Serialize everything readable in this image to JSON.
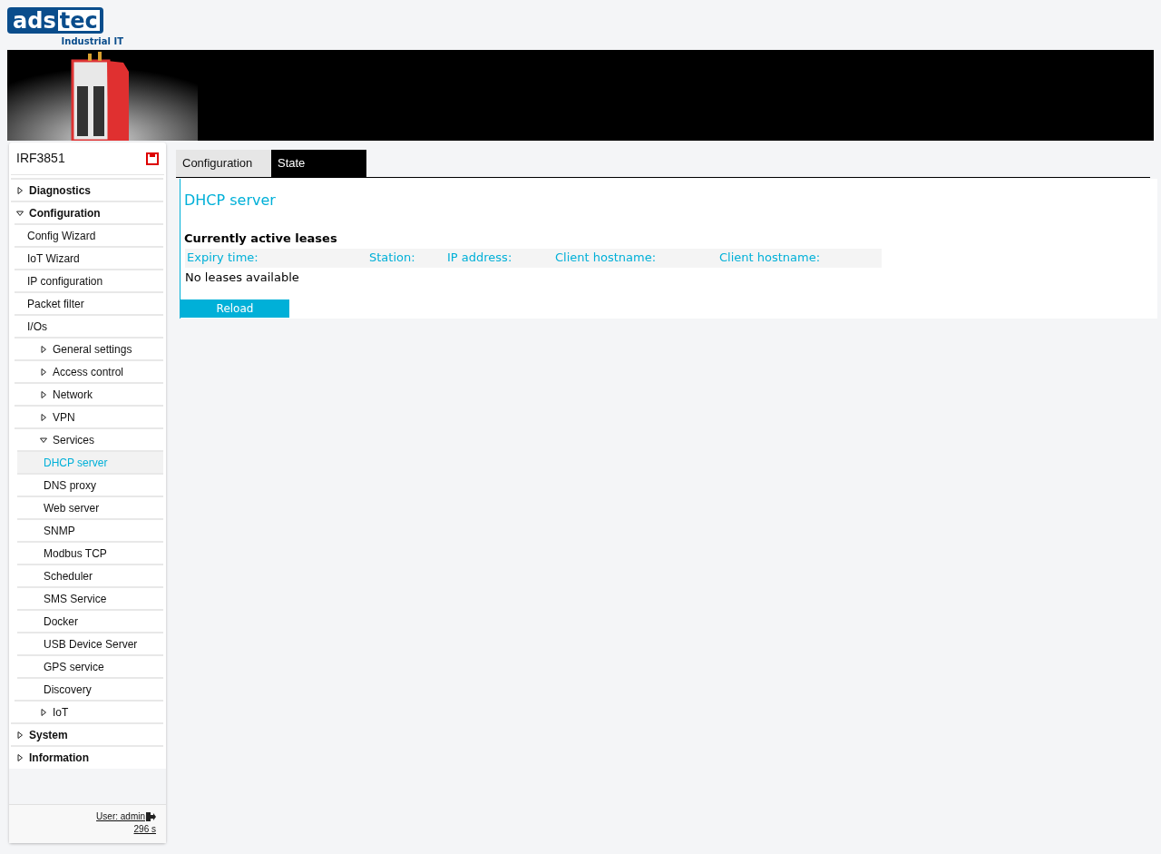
{
  "logo": {
    "part_1": "ads",
    "part_2": "tec",
    "tagline": "Industrial IT"
  },
  "sidebar": {
    "device": "IRF3851",
    "items": [
      {
        "label": "Diagnostics",
        "kind": "group",
        "expanded": false,
        "selected": false
      },
      {
        "label": "Configuration",
        "kind": "group",
        "expanded": true,
        "selected": false,
        "children": [
          {
            "label": "Config Wizard",
            "kind": "link",
            "selected": false
          },
          {
            "label": "IoT Wizard",
            "kind": "link",
            "selected": false
          },
          {
            "label": "IP configuration",
            "kind": "link",
            "selected": false
          },
          {
            "label": "Packet filter",
            "kind": "link",
            "selected": false
          },
          {
            "label": "I/Os",
            "kind": "link",
            "selected": false
          },
          {
            "label": "General settings",
            "kind": "group",
            "expanded": false,
            "selected": false
          },
          {
            "label": "Access control",
            "kind": "group",
            "expanded": false,
            "selected": false
          },
          {
            "label": "Network",
            "kind": "group",
            "expanded": false,
            "selected": false
          },
          {
            "label": "VPN",
            "kind": "group",
            "expanded": false,
            "selected": false
          },
          {
            "label": "Services",
            "kind": "group",
            "expanded": true,
            "selected": false,
            "children": [
              {
                "label": "DHCP server",
                "kind": "link",
                "selected": true
              },
              {
                "label": "DNS proxy",
                "kind": "link",
                "selected": false
              },
              {
                "label": "Web server",
                "kind": "link",
                "selected": false
              },
              {
                "label": "SNMP",
                "kind": "link",
                "selected": false
              },
              {
                "label": "Modbus TCP",
                "kind": "link",
                "selected": false
              },
              {
                "label": "Scheduler",
                "kind": "link",
                "selected": false
              },
              {
                "label": "SMS Service",
                "kind": "link",
                "selected": false
              },
              {
                "label": "Docker",
                "kind": "link",
                "selected": false
              },
              {
                "label": "USB Device Server",
                "kind": "link",
                "selected": false
              },
              {
                "label": "GPS service",
                "kind": "link",
                "selected": false
              },
              {
                "label": "Discovery",
                "kind": "link",
                "selected": false
              }
            ]
          },
          {
            "label": "IoT",
            "kind": "group",
            "expanded": false,
            "selected": false
          }
        ]
      },
      {
        "label": "System",
        "kind": "group",
        "expanded": false,
        "selected": false
      },
      {
        "label": "Information",
        "kind": "group",
        "expanded": false,
        "selected": false
      }
    ],
    "user": "User: admin",
    "timer": "296 s"
  },
  "tabs": [
    {
      "label": "Configuration",
      "selected": false
    },
    {
      "label": "State",
      "selected": true
    }
  ],
  "panel": {
    "title": "DHCP server",
    "section": "Currently active leases",
    "table": {
      "columns": [
        "Expiry time:",
        "Station:",
        "IP address:",
        "Client hostname:",
        "Client hostname:"
      ],
      "empty_text": "No leases available"
    },
    "button": "Reload"
  }
}
